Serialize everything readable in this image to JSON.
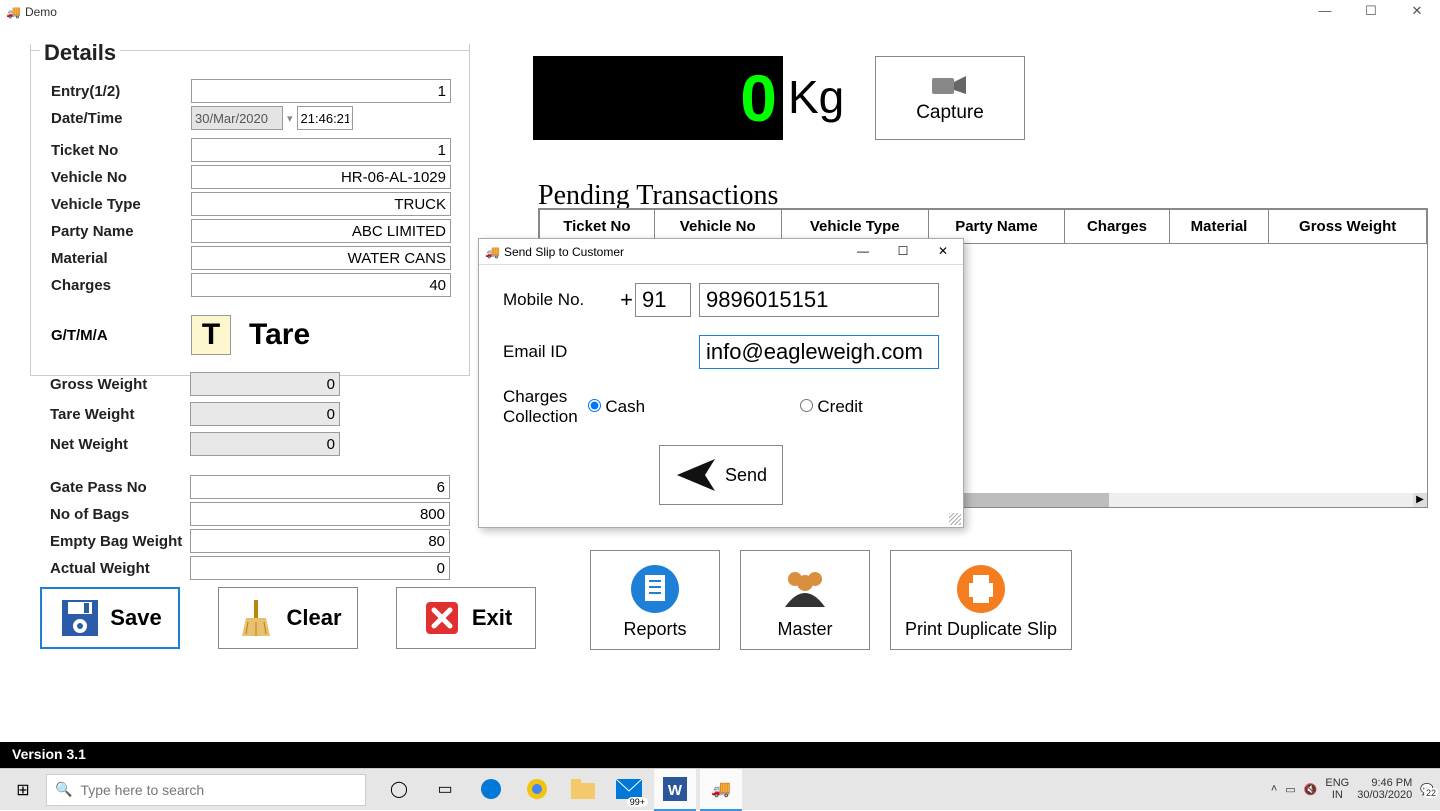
{
  "window": {
    "title": "Demo"
  },
  "details": {
    "heading": "Details",
    "entry_label": "Entry(1/2)",
    "entry": "1",
    "datetime_label": "Date/Time",
    "date": "30/Mar/2020",
    "time": "21:46:21",
    "ticket_label": "Ticket No",
    "ticket": "1",
    "vehicle_no_label": "Vehicle No",
    "vehicle_no": "HR-06-AL-1029",
    "vehicle_type_label": "Vehicle Type",
    "vehicle_type": "TRUCK",
    "party_label": "Party Name",
    "party": "ABC LIMITED",
    "material_label": "Material",
    "material": "WATER CANS",
    "charges_label": "Charges",
    "charges": "40",
    "gtma_label": "G/T/M/A",
    "gtma_letter": "T",
    "gtma_text": "Tare"
  },
  "weights": {
    "gross_label": "Gross Weight",
    "gross": "0",
    "tare_label": "Tare Weight",
    "tare": "0",
    "net_label": "Net Weight",
    "net": "0"
  },
  "bags": {
    "gate_label": "Gate Pass No",
    "gate": "6",
    "nbags_label": "No of Bags",
    "nbags": "800",
    "empty_label": "Empty Bag Weight",
    "empty": "80",
    "actual_label": "Actual Weight",
    "actual": "0"
  },
  "display": {
    "weight": "0",
    "unit": "Kg",
    "capture": "Capture"
  },
  "pending": {
    "title": "Pending Transactions",
    "cols": [
      "Ticket No",
      "Vehicle No",
      "Vehicle Type",
      "Party Name",
      "Charges",
      "Material",
      "Gross Weight"
    ]
  },
  "buttons": {
    "save": "Save",
    "clear": "Clear",
    "exit": "Exit",
    "reports": "Reports",
    "master": "Master",
    "dup": "Print Duplicate Slip"
  },
  "modal": {
    "title": "Send Slip to Customer",
    "mobile_label": "Mobile No.",
    "cc": "91",
    "mobile": "9896015151",
    "email_label": "Email ID",
    "email": "info@eagleweigh.com",
    "charges_label": "Charges Collection",
    "cash": "Cash",
    "credit": "Credit",
    "send": "Send"
  },
  "footer": {
    "version": "Version 3.1"
  },
  "taskbar": {
    "search_placeholder": "Type here to search",
    "badge": "99+",
    "lang1": "ENG",
    "lang2": "IN",
    "time": "9:46 PM",
    "date": "30/03/2020",
    "notif": "22"
  }
}
